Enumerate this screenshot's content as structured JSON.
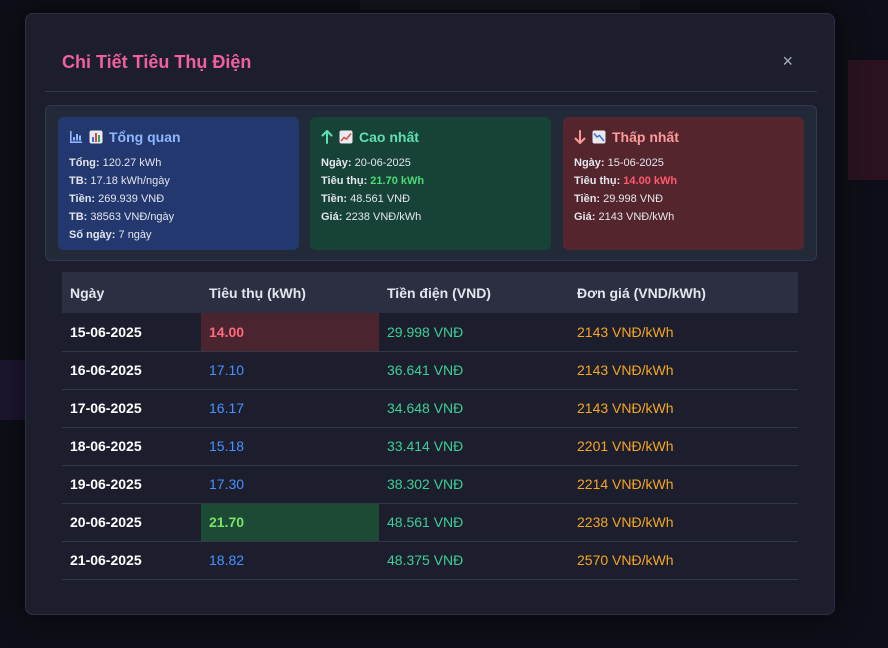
{
  "modal": {
    "title": "Chi Tiết Tiêu Thụ Điện",
    "close_label": "×"
  },
  "summary": {
    "overview": {
      "title": "Tổng quan",
      "total_label": "Tổng:",
      "total_value": "120.27 kWh",
      "avg_label": "TB:",
      "avg_value": "17.18 kWh/ngày",
      "money_label": "Tiền:",
      "money_value": "269.939 VNĐ",
      "avg_money_label": "TB:",
      "avg_money_value": "38563 VNĐ/ngày",
      "days_label": "Số ngày:",
      "days_value": "7 ngày"
    },
    "highest": {
      "title": "Cao nhất",
      "date_label": "Ngày:",
      "date_value": "20-06-2025",
      "usage_label": "Tiêu thụ:",
      "usage_value": "21.70 kWh",
      "money_label": "Tiền:",
      "money_value": "48.561 VNĐ",
      "price_label": "Giá:",
      "price_value": "2238 VNĐ/kWh"
    },
    "lowest": {
      "title": "Thấp nhất",
      "date_label": "Ngày:",
      "date_value": "15-06-2025",
      "usage_label": "Tiêu thụ:",
      "usage_value": "14.00 kWh",
      "money_label": "Tiền:",
      "money_value": "29.998 VNĐ",
      "price_label": "Giá:",
      "price_value": "2143 VNĐ/kWh"
    }
  },
  "table": {
    "headers": [
      "Ngày",
      "Tiêu thụ (kWh)",
      "Tiền điện (VND)",
      "Đơn giá (VND/kWh)"
    ],
    "rows": [
      {
        "date": "15-06-2025",
        "usage": "14.00",
        "cost": "29.998 VNĐ",
        "price": "2143 VNĐ/kWh",
        "highlight": "low"
      },
      {
        "date": "16-06-2025",
        "usage": "17.10",
        "cost": "36.641 VNĐ",
        "price": "2143 VNĐ/kWh",
        "highlight": ""
      },
      {
        "date": "17-06-2025",
        "usage": "16.17",
        "cost": "34.648 VNĐ",
        "price": "2143 VNĐ/kWh",
        "highlight": ""
      },
      {
        "date": "18-06-2025",
        "usage": "15.18",
        "cost": "33.414 VNĐ",
        "price": "2201 VNĐ/kWh",
        "highlight": ""
      },
      {
        "date": "19-06-2025",
        "usage": "17.30",
        "cost": "38.302 VNĐ",
        "price": "2214 VNĐ/kWh",
        "highlight": ""
      },
      {
        "date": "20-06-2025",
        "usage": "21.70",
        "cost": "48.561 VNĐ",
        "price": "2238 VNĐ/kWh",
        "highlight": "high"
      },
      {
        "date": "21-06-2025",
        "usage": "18.82",
        "cost": "48.375 VNĐ",
        "price": "2570 VNĐ/kWh",
        "highlight": ""
      }
    ]
  },
  "colors": {
    "title": "#f0609e",
    "overview_card": "#22386e",
    "highest_card": "#164238",
    "lowest_card": "#55252d",
    "usage": "#4a90ff",
    "cost": "#3ccf95",
    "price": "#f5a623"
  },
  "icons": {
    "overview": [
      "bar-chart-icon",
      "chart-emoji-icon"
    ],
    "highest": [
      "arrow-up-icon",
      "trend-up-icon"
    ],
    "lowest": [
      "arrow-down-icon",
      "trend-down-icon"
    ]
  }
}
